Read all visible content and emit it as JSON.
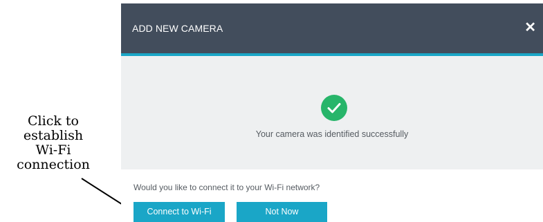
{
  "annotation": {
    "lines": [
      "Click to",
      "establish",
      "Wi-Fi",
      "connection"
    ]
  },
  "dialog": {
    "title": "ADD NEW CAMERA",
    "close_glyph": "✕",
    "status_icon": "check-circle-icon",
    "success_message": "Your camera was identified successfully",
    "question": "Would you like to connect it to your Wi-Fi network?",
    "connect_label": "Connect to Wi-Fi",
    "not_now_label": "Not Now"
  },
  "colors": {
    "header_bg": "#424d5c",
    "accent": "#1aa6c7",
    "success": "#27b56a",
    "body_bg": "#eef0f1"
  }
}
